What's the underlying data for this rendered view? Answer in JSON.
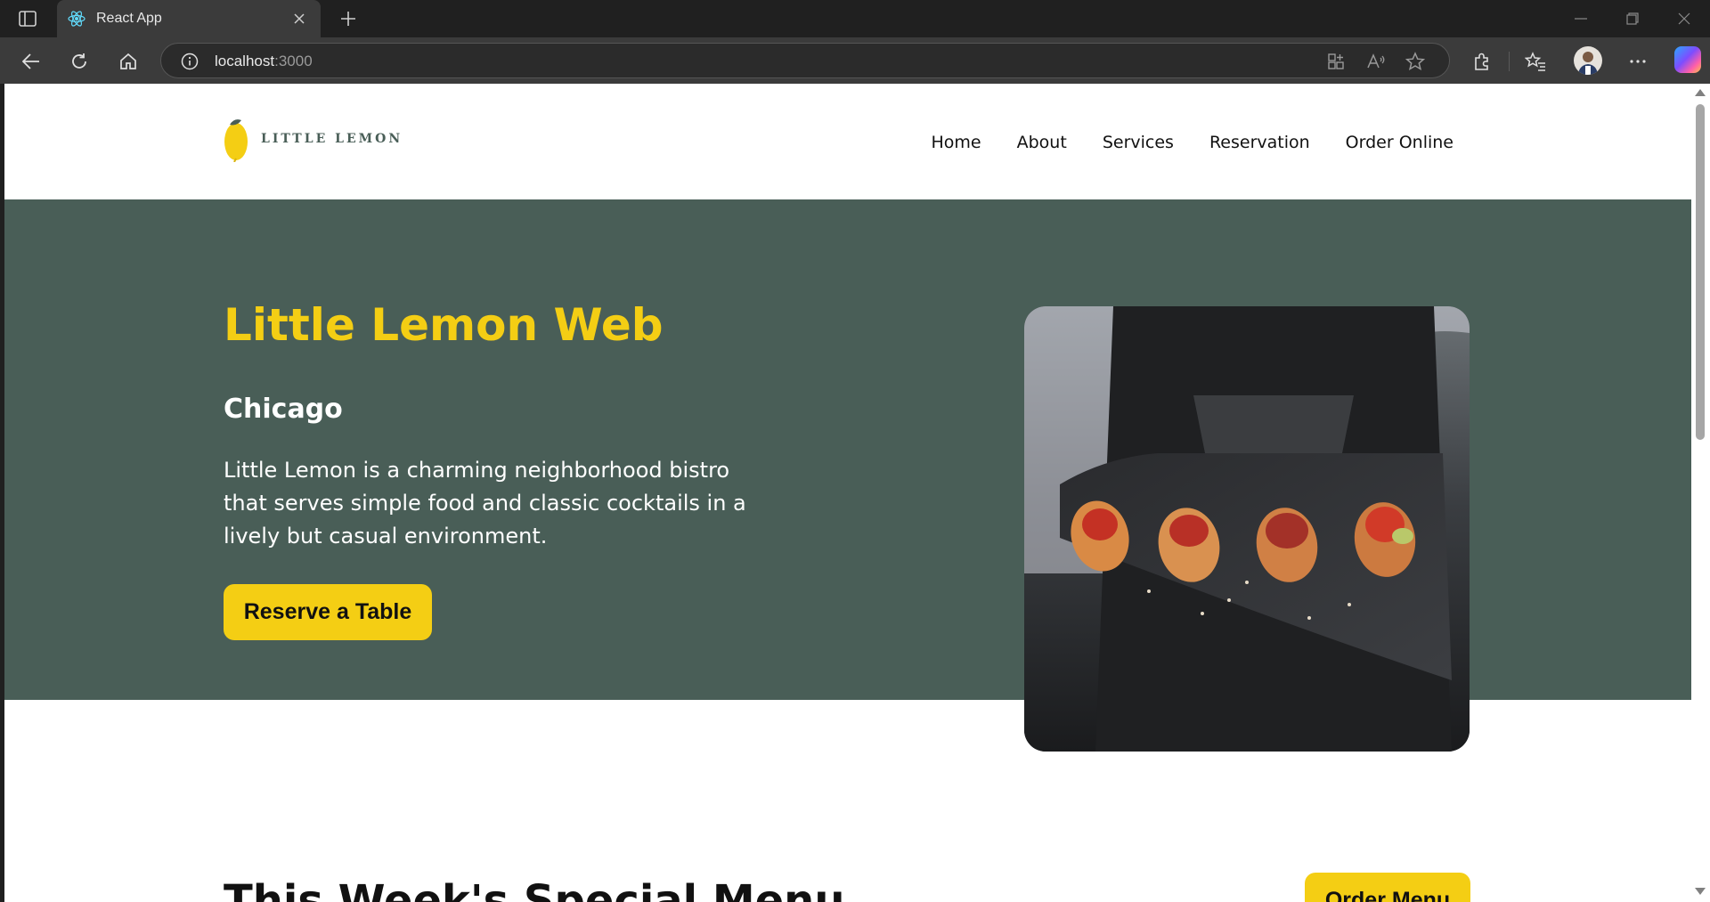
{
  "browser": {
    "tab_title": "React App",
    "url_host": "localhost",
    "url_port": ":3000"
  },
  "site": {
    "logo_text": "LITTLE LEMON",
    "nav": [
      "Home",
      "About",
      "Services",
      "Reservation",
      "Order Online"
    ]
  },
  "hero": {
    "title": "Little Lemon Web",
    "subtitle": "Chicago",
    "description": "Little Lemon is a charming neighborhood bistro that serves simple food and classic cocktails in a lively but casual environment.",
    "cta_label": "Reserve a Table"
  },
  "specials": {
    "title": "This Week's Special Menu",
    "cta_label": "Order Menu"
  },
  "colors": {
    "brand_green": "#495e57",
    "brand_yellow": "#f4ce14"
  }
}
